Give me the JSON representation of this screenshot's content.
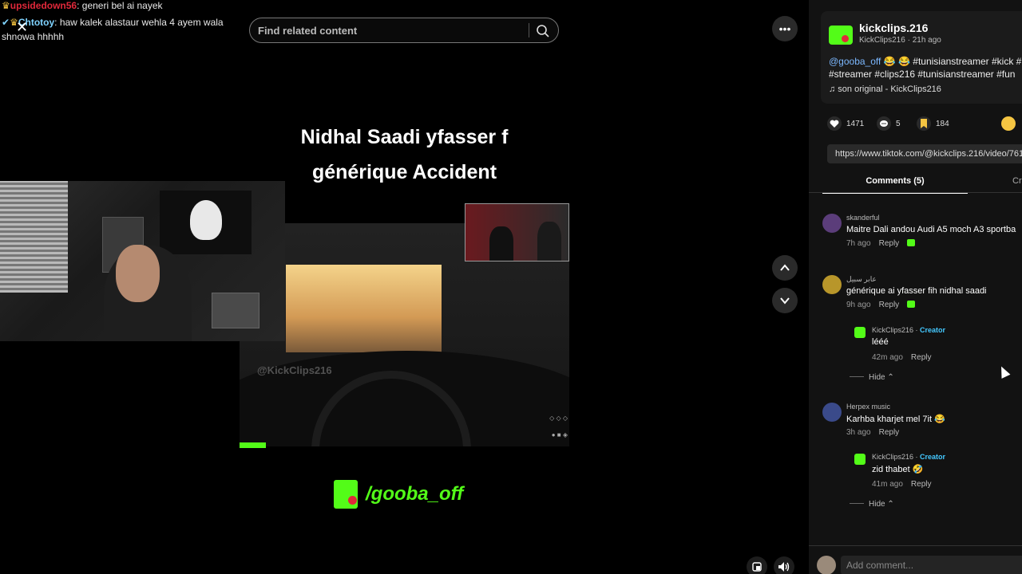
{
  "chat": {
    "messages": [
      {
        "user": "upsidedown56",
        "text": ": generi bel ai nayek"
      },
      {
        "user": "Chtotoy",
        "text": ": haw kalek alastaur wehla 4 ayem wala",
        "continuation": "shnowa hhhhh"
      }
    ],
    "close_glyph": "✕"
  },
  "video": {
    "search_placeholder": "Find related content",
    "title_line1": "Nidhal Saadi yfasser f",
    "title_line2": "générique Accident",
    "watermark": "@KickClips216",
    "brand_handle": "/gooba_off",
    "progress_fraction": 0.08
  },
  "controls": {
    "more_glyph": "•••",
    "up_glyph": "⌃",
    "down_glyph": "⌄"
  },
  "post": {
    "username": "kickclips.216",
    "meta": "KickClips216 · 21h ago",
    "mention": "@gooba_off",
    "emojis": "😂 😂",
    "tags_line1": "#tunisianstreamer #kick #",
    "tags_line2": "#streamer #clips216 #tunisianstreamer #fun",
    "music": "♫  son original - KickClips216",
    "likes": "1471",
    "comments_count": "5",
    "saves": "184",
    "url": "https://www.tiktok.com/@kickclips.216/video/761"
  },
  "tabs": {
    "comments": "Comments (5)",
    "creator": "Cr"
  },
  "comments": [
    {
      "name": "skanderful",
      "text": "Maitre Dali andou Audi A5 moch A3 sportba",
      "time": "7h ago",
      "reply": "Reply",
      "avatar_color": "#5b3d7a"
    },
    {
      "name": "عابر سبيل",
      "text": "générique ai yfasser fih nidhal saadi",
      "time": "9h ago",
      "reply": "Reply",
      "avatar_color": "#b8962a"
    },
    {
      "name": "KickClips216",
      "creator_label": "Creator",
      "text": "lééé",
      "time": "42m ago",
      "reply": "Reply",
      "avatar_color": "#53fc18"
    },
    {
      "name": "Herpex music",
      "text": "Karhba kharjet mel 7it 😂",
      "time": "3h ago",
      "reply": "Reply",
      "avatar_color": "#3a4a8a"
    },
    {
      "name": "KickClips216",
      "creator_label": "Creator",
      "text": "zid thabet 🤣",
      "time": "41m ago",
      "reply": "Reply",
      "avatar_color": "#53fc18"
    }
  ],
  "hide_label": "Hide ⌃",
  "add_comment_placeholder": "Add comment...",
  "colors": {
    "kick_green": "#53fc18",
    "creator_blue": "#44c8ff",
    "mention_blue": "#7cb8ff"
  }
}
